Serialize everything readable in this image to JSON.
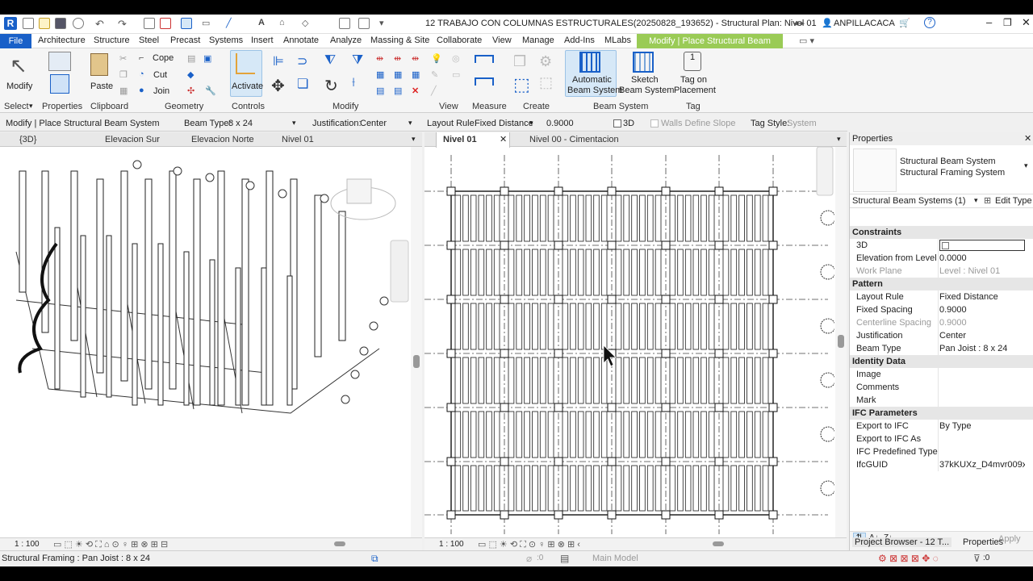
{
  "window": {
    "title": "12 TRABAJO CON COLUMNAS ESTRUCTURALES(20250828_193652) - Structural Plan: Nivel 01",
    "user": "ANPILLACACA"
  },
  "menu": {
    "file": "File",
    "items": [
      "Architecture",
      "Structure",
      "Steel",
      "Precast",
      "Systems",
      "Insert",
      "Annotate",
      "Analyze",
      "Massing & Site",
      "Collaborate",
      "View",
      "Manage",
      "Add-Ins",
      "MLabs"
    ],
    "context_tab": "Modify | Place Structural Beam System"
  },
  "ribbon": {
    "modify": "Modify",
    "paste": "Paste",
    "cope": "Cope",
    "cut": "Cut",
    "join": "Join",
    "activate": "Activate",
    "auto_beam_1": "Automatic",
    "auto_beam_2": "Beam System",
    "sketch_1": "Sketch",
    "sketch_2": "Beam System",
    "tag_1": "Tag on",
    "tag_2": "Placement",
    "panels": {
      "select": "Select",
      "properties": "Properties",
      "clipboard": "Clipboard",
      "geometry": "Geometry",
      "controls": "Controls",
      "modify": "Modify",
      "view": "View",
      "measure": "Measure",
      "create": "Create",
      "beam_system": "Beam System",
      "tag": "Tag"
    }
  },
  "options_bar": {
    "mode": "Modify | Place Structural Beam System",
    "beam_type_label": "Beam Type:",
    "beam_type_value": "8 x 24",
    "justification_label": "Justification:",
    "justification_value": "Center",
    "layout_rule_label": "Layout Rule:",
    "layout_rule_value": "Fixed Distance",
    "spacing_value": "0.9000",
    "three_d": "3D",
    "walls_define_slope": "Walls Define Slope",
    "tag_style_label": "Tag Style:",
    "tag_style_value": "System"
  },
  "views": {
    "left_tabs": [
      "{3D}",
      "Elevacion Sur",
      "Elevacion Norte",
      "Nivel 01"
    ],
    "right_tabs": [
      "Nivel 01",
      "Nivel 00 - Cimentacion"
    ],
    "left_scale": "1 : 100",
    "right_scale": "1 : 100"
  },
  "properties": {
    "title": "Properties",
    "type_name_1": "Structural Beam System",
    "type_name_2": "Structural Framing System",
    "selector": "Structural Beam Systems (1)",
    "edit_type": "Edit Type",
    "sections": {
      "constraints": "Constraints",
      "pattern": "Pattern",
      "identity": "Identity Data",
      "ifc": "IFC Parameters"
    },
    "rows": {
      "three_d": {
        "k": "3D",
        "v": ""
      },
      "elevation": {
        "k": "Elevation from Level",
        "v": "0.0000"
      },
      "work_plane": {
        "k": "Work Plane",
        "v": "Level : Nivel 01"
      },
      "layout_rule": {
        "k": "Layout Rule",
        "v": "Fixed Distance"
      },
      "fixed_spacing": {
        "k": "Fixed Spacing",
        "v": "0.9000"
      },
      "centerline_spacing": {
        "k": "Centerline Spacing",
        "v": "0.9000"
      },
      "justification": {
        "k": "Justification",
        "v": "Center"
      },
      "beam_type": {
        "k": "Beam Type",
        "v": "Pan Joist : 8 x 24"
      },
      "image": {
        "k": "Image",
        "v": ""
      },
      "comments": {
        "k": "Comments",
        "v": ""
      },
      "mark": {
        "k": "Mark",
        "v": ""
      },
      "export_ifc": {
        "k": "Export to IFC",
        "v": "By Type"
      },
      "export_ifc_as": {
        "k": "Export to IFC As",
        "v": ""
      },
      "ifc_predefined": {
        "k": "IFC Predefined Type",
        "v": ""
      },
      "ifc_guid": {
        "k": "IfcGUID",
        "v": "37kKUXz_D4mvr009x..."
      }
    },
    "apply": "Apply",
    "bottom_tab_browser": "Project Browser - 12 T...",
    "bottom_tab_props": "Properties"
  },
  "statusbar": {
    "text": "Structural Framing : Pan Joist : 8 x 24",
    "model": "Main Model",
    "worksets": ":0",
    "filter": ":0"
  },
  "colors": {
    "file_blue": "#1960c8",
    "context_green": "#9acb56"
  }
}
